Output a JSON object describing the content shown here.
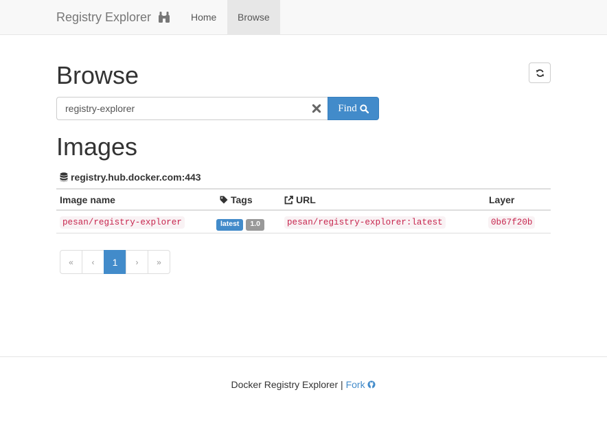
{
  "navbar": {
    "brand": "Registry Explorer",
    "brand_icon": "binoculars-icon",
    "items": [
      {
        "label": "Home"
      },
      {
        "label": "Browse",
        "active": true
      }
    ]
  },
  "page": {
    "title": "Browse",
    "refresh_icon": "refresh-icon"
  },
  "search": {
    "value": "registry-explorer",
    "find_label": "Find"
  },
  "images": {
    "heading": "Images",
    "registry": "registry.hub.docker.com:443",
    "columns": {
      "image_name": "Image name",
      "tags": "Tags",
      "url": "URL",
      "layer": "Layer"
    },
    "rows": [
      {
        "image_name": "pesan/registry-explorer",
        "tags": [
          "latest",
          "1.0"
        ],
        "url": "pesan/registry-explorer:latest",
        "layer": "0b67f20b"
      }
    ]
  },
  "pagination": {
    "first": "«",
    "prev": "‹",
    "current": "1",
    "next": "›",
    "last": "»"
  },
  "footer": {
    "text": "Docker Registry Explorer",
    "separator": "|",
    "link": "Fork"
  },
  "colors": {
    "primary": "#428bca",
    "code": "#c7254e",
    "code_bg": "#f9f2f4"
  }
}
